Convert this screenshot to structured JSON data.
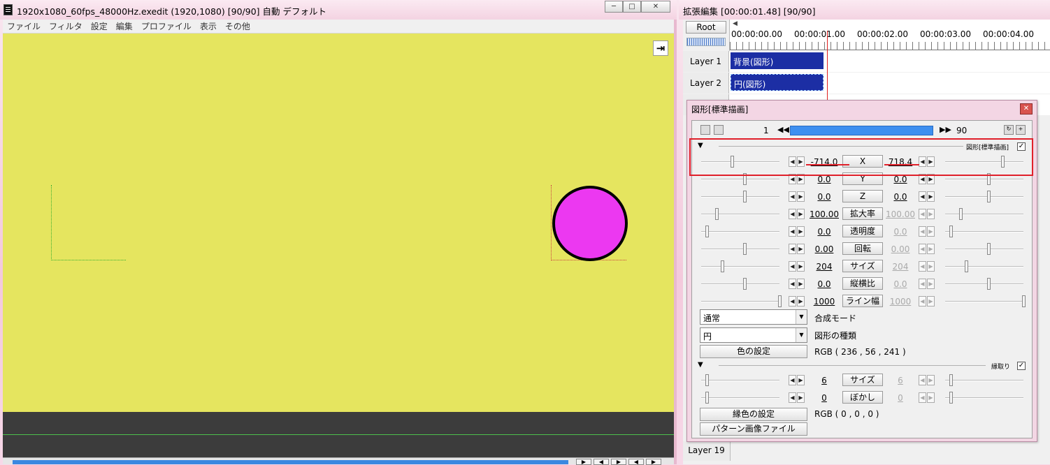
{
  "main_window": {
    "title": "1920x1080_60fps_48000Hz.exedit (1920,1080)  [90/90]  自動  デフォルト",
    "menu": [
      "ファイル",
      "フィルタ",
      "設定",
      "編集",
      "プロファイル",
      "表示",
      "その他"
    ],
    "preview_bg_color": "#e5e55f",
    "circle_color": "#ec38f1"
  },
  "timeline": {
    "title": "拡張編集 [00:00:01.48] [90/90]",
    "root_label": "Root",
    "ruler_labels": [
      "00:00:00.00",
      "00:00:01.00",
      "00:00:02.00",
      "00:00:03.00",
      "00:00:04.00"
    ],
    "layers": [
      {
        "name": "Layer 1",
        "clip": "背景(図形)"
      },
      {
        "name": "Layer 2",
        "clip": "円(図形)"
      }
    ],
    "last_layer": "Layer 19"
  },
  "dialog": {
    "title": "図形[標準描画]",
    "frame_start": "1",
    "frame_end": "90",
    "effect_label": "図形[標準描画]",
    "params": [
      {
        "name": "X",
        "left": "-714.0",
        "right": "718.4",
        "right_enabled": true
      },
      {
        "name": "Y",
        "left": "0.0",
        "right": "0.0",
        "right_enabled": true
      },
      {
        "name": "Z",
        "left": "0.0",
        "right": "0.0",
        "right_enabled": true
      },
      {
        "name": "拡大率",
        "left": "100.00",
        "right": "100.00",
        "right_enabled": false
      },
      {
        "name": "透明度",
        "left": "0.0",
        "right": "0.0",
        "right_enabled": false
      },
      {
        "name": "回転",
        "left": "0.00",
        "right": "0.00",
        "right_enabled": false
      },
      {
        "name": "サイズ",
        "left": "204",
        "right": "204",
        "right_enabled": false
      },
      {
        "name": "縦横比",
        "left": "0.0",
        "right": "0.0",
        "right_enabled": false
      },
      {
        "name": "ライン幅",
        "left": "1000",
        "right": "1000",
        "right_enabled": false
      }
    ],
    "blend_mode_value": "通常",
    "blend_mode_label": "合成モード",
    "shape_type_value": "円",
    "shape_type_label": "図形の種類",
    "color_button": "色の設定",
    "color_value": "RGB ( 236 , 56 , 241 )",
    "border_effect_label": "縁取り",
    "border_params": [
      {
        "name": "サイズ",
        "left": "6",
        "right": "6"
      },
      {
        "name": "ぼかし",
        "left": "0",
        "right": "0"
      }
    ],
    "border_color_button": "縁色の設定",
    "border_color_value": "RGB ( 0 , 0 , 0 )",
    "pattern_button": "パターン画像ファイル"
  }
}
